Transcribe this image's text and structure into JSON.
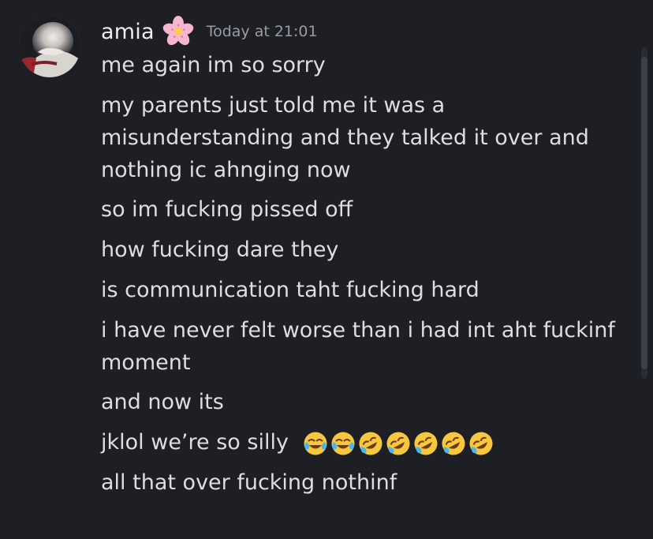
{
  "message": {
    "username": "amia",
    "timestamp": "Today at 21:01",
    "lines": [
      "me again im so sorry",
      "my parents just told me it was a misunderstanding and they talked it over and nothing ic ahnging now",
      "so im fucking pissed off",
      "how fucking dare they",
      "is communication taht fucking hard",
      "i have never felt worse than i had int aht fuckinf moment",
      "and now its",
      "jklol we’re so silly",
      "all that over fucking nothinf"
    ]
  },
  "icons": {
    "username_badge": "cherry-blossom-icon",
    "emoji_row": [
      "joy-icon",
      "joy-icon",
      "rofl-icon",
      "rofl-icon",
      "rofl-icon",
      "rofl-icon",
      "rofl-icon"
    ]
  },
  "colors": {
    "background": "#1e1f24",
    "username": "#f3e9ee",
    "text": "#dcdee2",
    "timestamp": "#9a9ca4",
    "scrollbar": "#3d4047"
  }
}
